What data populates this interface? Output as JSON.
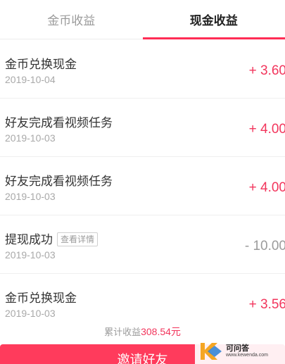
{
  "tabs": [
    {
      "label": "金币收益",
      "active": false
    },
    {
      "label": "现金收益",
      "active": true
    }
  ],
  "records": [
    {
      "title": "金币兑换现金",
      "date": "2019-10-04",
      "amount": "+ 3.60",
      "negative": false
    },
    {
      "title": "好友完成看视频任务",
      "date": "2019-10-03",
      "amount": "+ 4.00",
      "negative": false
    },
    {
      "title": "好友完成看视频任务",
      "date": "2019-10-03",
      "amount": "+ 4.00",
      "negative": false
    },
    {
      "title": "提现成功",
      "date": "2019-10-03",
      "amount": "- 10.00",
      "negative": true,
      "tag": "查看详情"
    },
    {
      "title": "金币兑换现金",
      "date": "2019-10-03",
      "amount": "+ 3.56",
      "negative": false
    }
  ],
  "summary": {
    "label": "累计收益",
    "value": "308.54元"
  },
  "invite": {
    "label": "邀请好友"
  },
  "watermark": {
    "name": "可问答",
    "url": "www.kewenda.com"
  },
  "colors": {
    "accent": "#ff2d55",
    "amount_positive": "#f2355c",
    "amount_negative": "#9b9b9b"
  }
}
